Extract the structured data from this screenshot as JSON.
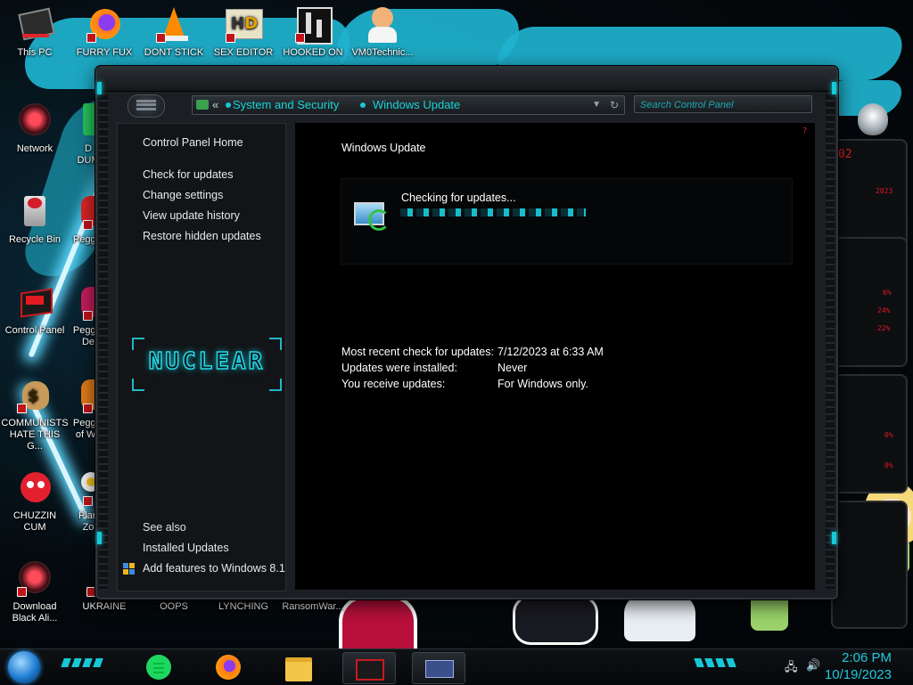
{
  "desktop": {
    "icons": [
      {
        "label": "This PC"
      },
      {
        "label": "FURRY FUX"
      },
      {
        "label": "DONT STICK"
      },
      {
        "label": "SEX EDITOR"
      },
      {
        "label": "HOOKED ON"
      },
      {
        "label": "VM0Technic..."
      },
      {
        "label": "Network"
      },
      {
        "label": "D\nDUM"
      },
      {
        "label": "Recycle Bin"
      },
      {
        "label": "Peggle"
      },
      {
        "label": "Control Panel"
      },
      {
        "label": "Peggle\nDe"
      },
      {
        "label": "COMMUNISTS\nHATE THIS G..."
      },
      {
        "label": "Peggle\nof Wa"
      },
      {
        "label": "CHUZZIN\nCUM"
      },
      {
        "label": "Plan\nZo"
      },
      {
        "label": "Download\nBlack Ali..."
      },
      {
        "label": "UKRAINE"
      },
      {
        "label": "OOPS"
      },
      {
        "label": "LYNCHING"
      },
      {
        "label": "RansomWar..."
      }
    ]
  },
  "window": {
    "breadcrumb": [
      "System and Security",
      "Windows Update"
    ],
    "search_placeholder": "Search Control Panel",
    "sidebar": {
      "home": "Control Panel Home",
      "links": [
        "Check for updates",
        "Change settings",
        "View update history",
        "Restore hidden updates"
      ],
      "logo_text": "NUCLEAR",
      "see_also_heading": "See also",
      "see_also": [
        "Installed Updates",
        "Add features to Windows 8.1"
      ]
    },
    "main": {
      "title": "Windows Update",
      "status": "Checking for updates...",
      "progress": 1.0,
      "info": [
        {
          "label": "Most recent check for updates:",
          "value": "7/12/2023 at 6:33 AM"
        },
        {
          "label": "Updates were installed:",
          "value": "Never"
        },
        {
          "label": "You receive updates:",
          "value": "For Windows only."
        }
      ]
    }
  },
  "gadget": {
    "readouts": [
      "02",
      "2023",
      "6%",
      "24%",
      "22%",
      "0%",
      "0%"
    ]
  },
  "taskbar": {
    "apps": [
      {
        "icon": "spotify-icon"
      },
      {
        "icon": "firefox-icon"
      },
      {
        "icon": "file-explorer-icon"
      },
      {
        "icon": "control-panel-icon"
      },
      {
        "icon": "window-app-icon"
      }
    ],
    "time": "2:06 PM",
    "date": "10/19/2023"
  },
  "colors": {
    "accent": "#18d3d8",
    "alert": "#e01823"
  }
}
